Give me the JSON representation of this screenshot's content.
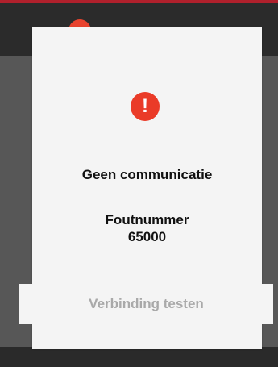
{
  "colors": {
    "background": "#575757",
    "topbar": "#2b2b2b",
    "accent_border": "#b0202c",
    "dialog": "#f4f4f4",
    "alert_red": "#ea3b28",
    "text_dark": "#111111",
    "text_muted": "#a9a9a9"
  },
  "dialog": {
    "icon": "exclamation-circle-icon",
    "icon_glyph": "!",
    "title": "Geen communicatie",
    "error_label": "Foutnummer",
    "error_code": "65000",
    "action_label": "Verbinding testen"
  }
}
